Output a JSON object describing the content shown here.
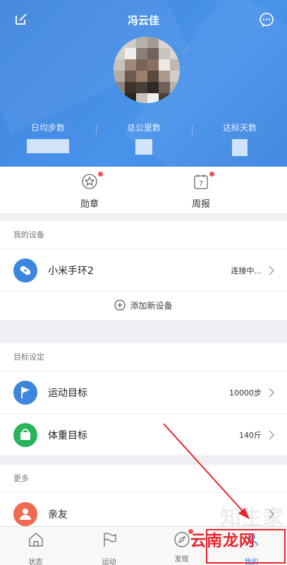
{
  "header": {
    "username": "冯云佳",
    "stats": [
      {
        "label": "日均步数"
      },
      {
        "label": "总公里数"
      },
      {
        "label": "达标天数"
      }
    ]
  },
  "quick": {
    "medal_label": "勋章",
    "weekly_label": "周报",
    "weekly_day": "7"
  },
  "devices": {
    "section_title": "我的设备",
    "device_name": "小米手环2",
    "device_status": "连接中...",
    "add_device": "添加新设备"
  },
  "goals": {
    "section_title": "目标设定",
    "items": [
      {
        "label": "运动目标",
        "value": "10000步"
      },
      {
        "label": "体重目标",
        "value": "140斤"
      }
    ]
  },
  "more": {
    "section_title": "更多",
    "items": [
      {
        "label": "亲友"
      }
    ]
  },
  "tabbar": {
    "items": [
      {
        "label": "状态"
      },
      {
        "label": "运动"
      },
      {
        "label": "发现"
      },
      {
        "label": "我的"
      }
    ]
  },
  "watermark": {
    "text": "云南龙网",
    "faint": "知生家"
  },
  "colors": {
    "header_blue": "#3c83dd",
    "device_blue": "#3d86de",
    "goal_blue": "#3d86de",
    "weight_green": "#27b45a",
    "friend_orange": "#ef6a4e",
    "badge_red": "#f2545b",
    "annotation_red": "#e8262b"
  }
}
